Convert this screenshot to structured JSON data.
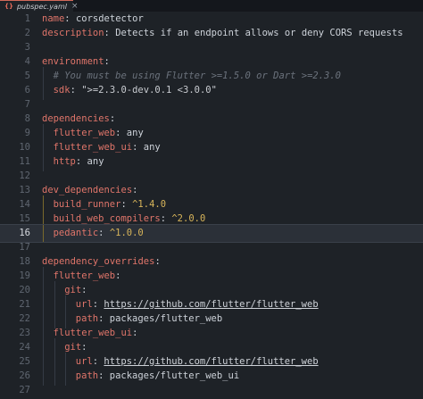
{
  "tab": {
    "icon": "{}",
    "title": "pubspec.yaml",
    "close": "×"
  },
  "lines": [
    {
      "n": "1",
      "tokens": [
        {
          "t": "name",
          "c": "k"
        },
        {
          "t": ": ",
          "c": "p"
        },
        {
          "t": "corsdetector",
          "c": "v"
        }
      ]
    },
    {
      "n": "2",
      "tokens": [
        {
          "t": "description",
          "c": "k"
        },
        {
          "t": ": ",
          "c": "p"
        },
        {
          "t": "Detects if an endpoint allows or deny CORS requests",
          "c": "v"
        }
      ]
    },
    {
      "n": "3",
      "tokens": []
    },
    {
      "n": "4",
      "tokens": [
        {
          "t": "environment",
          "c": "k"
        },
        {
          "t": ":",
          "c": "p"
        }
      ]
    },
    {
      "n": "5",
      "indent": 1,
      "tokens": [
        {
          "t": "# You must be using Flutter >=1.5.0 or Dart >=2.3.0",
          "c": "c"
        }
      ]
    },
    {
      "n": "6",
      "indent": 1,
      "tokens": [
        {
          "t": "sdk",
          "c": "k"
        },
        {
          "t": ": ",
          "c": "p"
        },
        {
          "t": "\">=2.3.0-dev.0.1 <3.0.0\"",
          "c": "s"
        }
      ]
    },
    {
      "n": "7",
      "tokens": []
    },
    {
      "n": "8",
      "tokens": [
        {
          "t": "dependencies",
          "c": "k"
        },
        {
          "t": ":",
          "c": "p"
        }
      ]
    },
    {
      "n": "9",
      "indent": 1,
      "tokens": [
        {
          "t": "flutter_web",
          "c": "k"
        },
        {
          "t": ": ",
          "c": "p"
        },
        {
          "t": "any",
          "c": "v"
        }
      ]
    },
    {
      "n": "10",
      "indent": 1,
      "tokens": [
        {
          "t": "flutter_web_ui",
          "c": "k"
        },
        {
          "t": ": ",
          "c": "p"
        },
        {
          "t": "any",
          "c": "v"
        }
      ]
    },
    {
      "n": "11",
      "indent": 1,
      "tokens": [
        {
          "t": "http",
          "c": "k"
        },
        {
          "t": ": ",
          "c": "p"
        },
        {
          "t": "any",
          "c": "v"
        }
      ]
    },
    {
      "n": "12",
      "tokens": []
    },
    {
      "n": "13",
      "tokens": [
        {
          "t": "dev_dependencies",
          "c": "k"
        },
        {
          "t": ":",
          "c": "p"
        }
      ]
    },
    {
      "n": "14",
      "indent": 1,
      "hl": true,
      "tokens": [
        {
          "t": "build_runner",
          "c": "k"
        },
        {
          "t": ": ",
          "c": "p"
        },
        {
          "t": "^1.4.0",
          "c": "n"
        }
      ]
    },
    {
      "n": "15",
      "indent": 1,
      "hl": true,
      "tokens": [
        {
          "t": "build_web_compilers",
          "c": "k"
        },
        {
          "t": ": ",
          "c": "p"
        },
        {
          "t": "^2.0.0",
          "c": "n"
        }
      ]
    },
    {
      "n": "16",
      "indent": 1,
      "hl": true,
      "active": true,
      "tokens": [
        {
          "t": "pedantic",
          "c": "k"
        },
        {
          "t": ": ",
          "c": "p"
        },
        {
          "t": "^1.0.0",
          "c": "n"
        }
      ]
    },
    {
      "n": "17",
      "tokens": []
    },
    {
      "n": "18",
      "tokens": [
        {
          "t": "dependency_overrides",
          "c": "k"
        },
        {
          "t": ":",
          "c": "p"
        }
      ]
    },
    {
      "n": "19",
      "indent": 1,
      "tokens": [
        {
          "t": "flutter_web",
          "c": "k"
        },
        {
          "t": ":",
          "c": "p"
        }
      ]
    },
    {
      "n": "20",
      "indent": 2,
      "tokens": [
        {
          "t": "git",
          "c": "k"
        },
        {
          "t": ":",
          "c": "p"
        }
      ]
    },
    {
      "n": "21",
      "indent": 3,
      "tokens": [
        {
          "t": "url",
          "c": "k"
        },
        {
          "t": ": ",
          "c": "p"
        },
        {
          "t": "https://github.com/flutter/flutter_web",
          "c": "u"
        }
      ]
    },
    {
      "n": "22",
      "indent": 3,
      "tokens": [
        {
          "t": "path",
          "c": "k"
        },
        {
          "t": ": ",
          "c": "p"
        },
        {
          "t": "packages/flutter_web",
          "c": "v"
        }
      ]
    },
    {
      "n": "23",
      "indent": 1,
      "tokens": [
        {
          "t": "flutter_web_ui",
          "c": "k"
        },
        {
          "t": ":",
          "c": "p"
        }
      ]
    },
    {
      "n": "24",
      "indent": 2,
      "tokens": [
        {
          "t": "git",
          "c": "k"
        },
        {
          "t": ":",
          "c": "p"
        }
      ]
    },
    {
      "n": "25",
      "indent": 3,
      "tokens": [
        {
          "t": "url",
          "c": "k"
        },
        {
          "t": ": ",
          "c": "p"
        },
        {
          "t": "https://github.com/flutter/flutter_web",
          "c": "u"
        }
      ]
    },
    {
      "n": "26",
      "indent": 3,
      "tokens": [
        {
          "t": "path",
          "c": "k"
        },
        {
          "t": ": ",
          "c": "p"
        },
        {
          "t": "packages/flutter_web_ui",
          "c": "v"
        }
      ]
    },
    {
      "n": "27",
      "tokens": []
    }
  ]
}
